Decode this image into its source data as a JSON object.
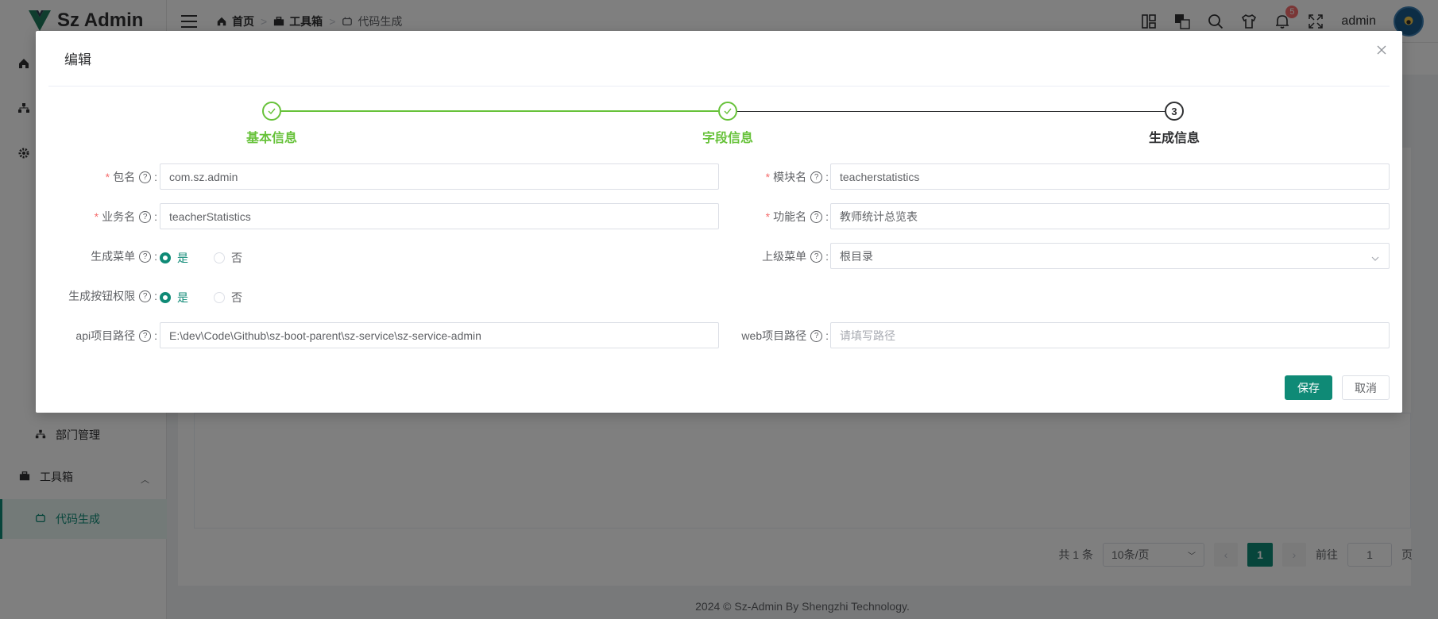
{
  "app": {
    "name": "Sz Admin"
  },
  "breadcrumb": [
    {
      "label": "首页",
      "icon": "home-icon"
    },
    {
      "label": "工具箱",
      "icon": "toolbox-icon"
    },
    {
      "label": "代码生成",
      "icon": "code-gen-icon"
    }
  ],
  "header": {
    "user": "admin",
    "notification_count": "5"
  },
  "sidebar": {
    "items": [
      {
        "label": "部门管理",
        "icon": "org-icon"
      },
      {
        "label": "工具箱",
        "icon": "toolbox-icon"
      },
      {
        "label": "代码生成",
        "icon": "code-gen-icon"
      }
    ]
  },
  "pagination": {
    "total": "共 1 条",
    "page_size": "10条/页",
    "current": "1",
    "goto_prefix": "前往",
    "goto_value": "1",
    "goto_suffix": "页"
  },
  "footer": {
    "text": "2024 © Sz-Admin By Shengzhi Technology."
  },
  "dialog": {
    "title": "编辑",
    "steps": [
      {
        "label": "基本信息",
        "status": "done"
      },
      {
        "label": "字段信息",
        "status": "done"
      },
      {
        "label": "生成信息",
        "status": "current",
        "number": "3"
      }
    ],
    "fields": {
      "package_name": {
        "label": "包名",
        "value": "com.sz.admin",
        "required": true
      },
      "module_name": {
        "label": "模块名",
        "value": "teacherstatistics",
        "required": true
      },
      "business_name": {
        "label": "业务名",
        "value": "teacherStatistics",
        "required": true
      },
      "function_name": {
        "label": "功能名",
        "value": "教师统计总览表",
        "required": true
      },
      "gen_menu": {
        "label": "生成菜单",
        "options": [
          "是",
          "否"
        ],
        "selected": "是"
      },
      "parent_menu": {
        "label": "上级菜单",
        "value": "根目录"
      },
      "gen_button_perm": {
        "label": "生成按钮权限",
        "options": [
          "是",
          "否"
        ],
        "selected": "是"
      },
      "api_path": {
        "label": "api项目路径",
        "value": "E:\\dev\\Code\\Github\\sz-boot-parent\\sz-service\\sz-service-admin"
      },
      "web_path": {
        "label": "web项目路径",
        "placeholder": "请填写路径",
        "value": ""
      }
    },
    "buttons": {
      "save": "保存",
      "cancel": "取消"
    }
  },
  "colors": {
    "primary": "#0f8a76",
    "step_done": "#67c23a",
    "required": "#f56c6c",
    "badge": "#f56c6c"
  }
}
